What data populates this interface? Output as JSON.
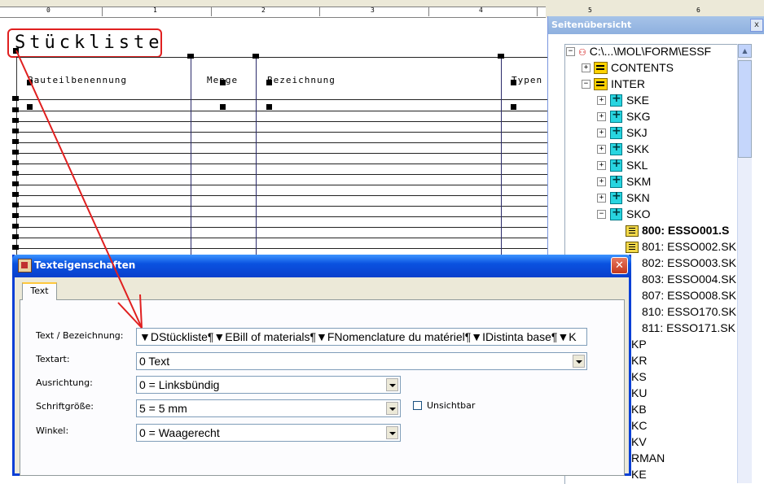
{
  "ruler": {
    "numbers": [
      "0",
      "1",
      "2",
      "3",
      "4",
      "5",
      "6"
    ]
  },
  "canvas": {
    "title": "Stückliste",
    "columns": [
      "Bauteilbenennung",
      "Menge",
      "Bezeichnung",
      "Typen"
    ]
  },
  "overview": {
    "title": "Seitenübersicht",
    "close": "x",
    "root": "C:\\...\\MOL\\FORM\\ESSF",
    "contents": "CONTENTS",
    "inter": "INTER",
    "groups": [
      "SKE",
      "SKG",
      "SKJ",
      "SKK",
      "SKL",
      "SKM",
      "SKN",
      "SKO"
    ],
    "pages": [
      "800: ESSO001.S",
      "801: ESSO002.SK",
      "802: ESSO003.SK",
      "803: ESSO004.SK",
      "807: ESSO008.SK",
      "810: ESSO170.SK",
      "811: ESSO171.SK"
    ],
    "hidden_items": [
      "KP",
      "KR",
      "KS",
      "KU",
      "KB",
      "KC",
      "KV",
      "RMAN",
      "KE"
    ]
  },
  "dialog": {
    "title": "Texteigenschaften",
    "close": "✕",
    "tab": "Text",
    "fields": {
      "text_label": "Text / Bezeichnung:",
      "text_value": "▼DStückliste¶▼EBill of materials¶▼FNomenclature du matériel¶▼IDistinta base¶▼K",
      "textart_label": "Textart:",
      "textart_value": "0 Text",
      "ausrichtung_label": "Ausrichtung:",
      "ausrichtung_value": "0 = Linksbündig",
      "schriftgroesse_label": "Schriftgröße:",
      "schriftgroesse_value": "5 = 5 mm",
      "winkel_label": "Winkel:",
      "winkel_value": "0 = Waagerecht",
      "unsichtbar_label": "Unsichtbar"
    }
  },
  "colors": {
    "highlight": "#e02020",
    "titlebar": "#0a52e0"
  }
}
